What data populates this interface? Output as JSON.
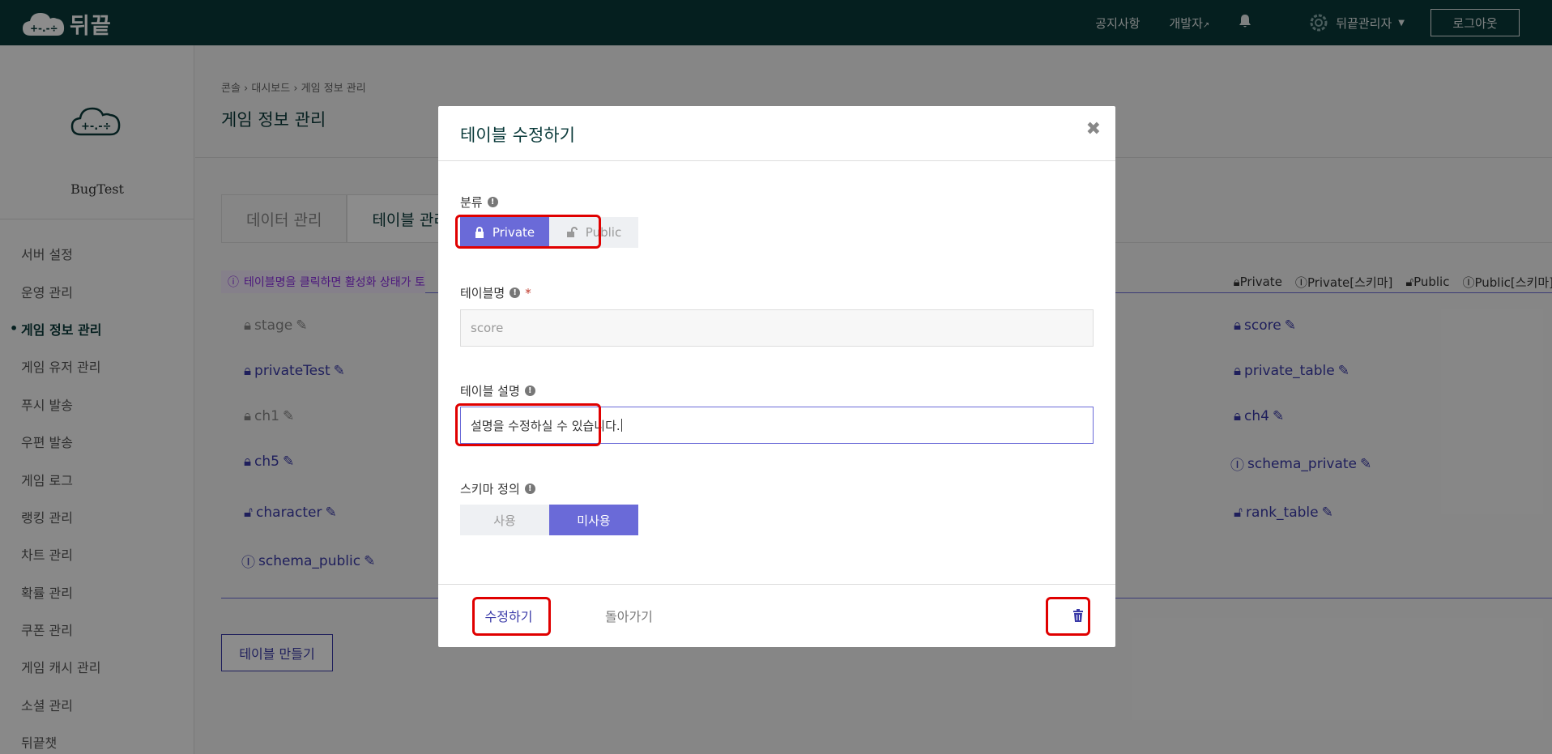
{
  "header": {
    "logo_text": "뒤끝",
    "nav": [
      "공지사항",
      "개발자"
    ],
    "user": "뒤끝관리자",
    "logout": "로그아웃"
  },
  "sidebar": {
    "project": "BugTest",
    "items": [
      "서버 설정",
      "운영 관리",
      "게임 정보 관리",
      "게임 유저 관리",
      "푸시 발송",
      "우편 발송",
      "게임 로그",
      "랭킹 관리",
      "차트 관리",
      "확률 관리",
      "쿠폰 관리",
      "게임 캐시 관리",
      "소셜 관리",
      "뒤끝챗"
    ]
  },
  "main": {
    "breadcrumb": "콘솔 › 대시보드 › 게임 정보 관리",
    "title": "게임 정보 관리",
    "tabs": [
      "데이터 관리",
      "테이블 관리"
    ],
    "info": "테이블명을 클릭하면 활성화 상태가 토",
    "legend": [
      "Private",
      "Private[스키마]",
      "Public",
      "Public[스키마]"
    ],
    "tables_left": [
      "stage",
      "privateTest",
      "ch1",
      "ch5",
      "character",
      "schema_public"
    ],
    "tables_right": [
      "score",
      "private_table",
      "ch4",
      "schema_private",
      "rank_table"
    ],
    "create_button": "테이블 만들기"
  },
  "modal": {
    "title": "테이블 수정하기",
    "category_label": "분류",
    "category_options": [
      "Private",
      "Public"
    ],
    "name_label": "테이블명",
    "name_required": "*",
    "name_value": "score",
    "desc_label": "테이블 설명",
    "desc_value": "설명을 수정하실 수 있습니다.",
    "schema_label": "스키마 정의",
    "schema_options": [
      "사용",
      "미사용"
    ],
    "edit_button": "수정하기",
    "back_button": "돌아가기"
  },
  "colors": {
    "topbar": "#0a3a3a",
    "accent": "#6a6ad8",
    "link": "#3a3aa8",
    "highlight": "#e00000"
  }
}
